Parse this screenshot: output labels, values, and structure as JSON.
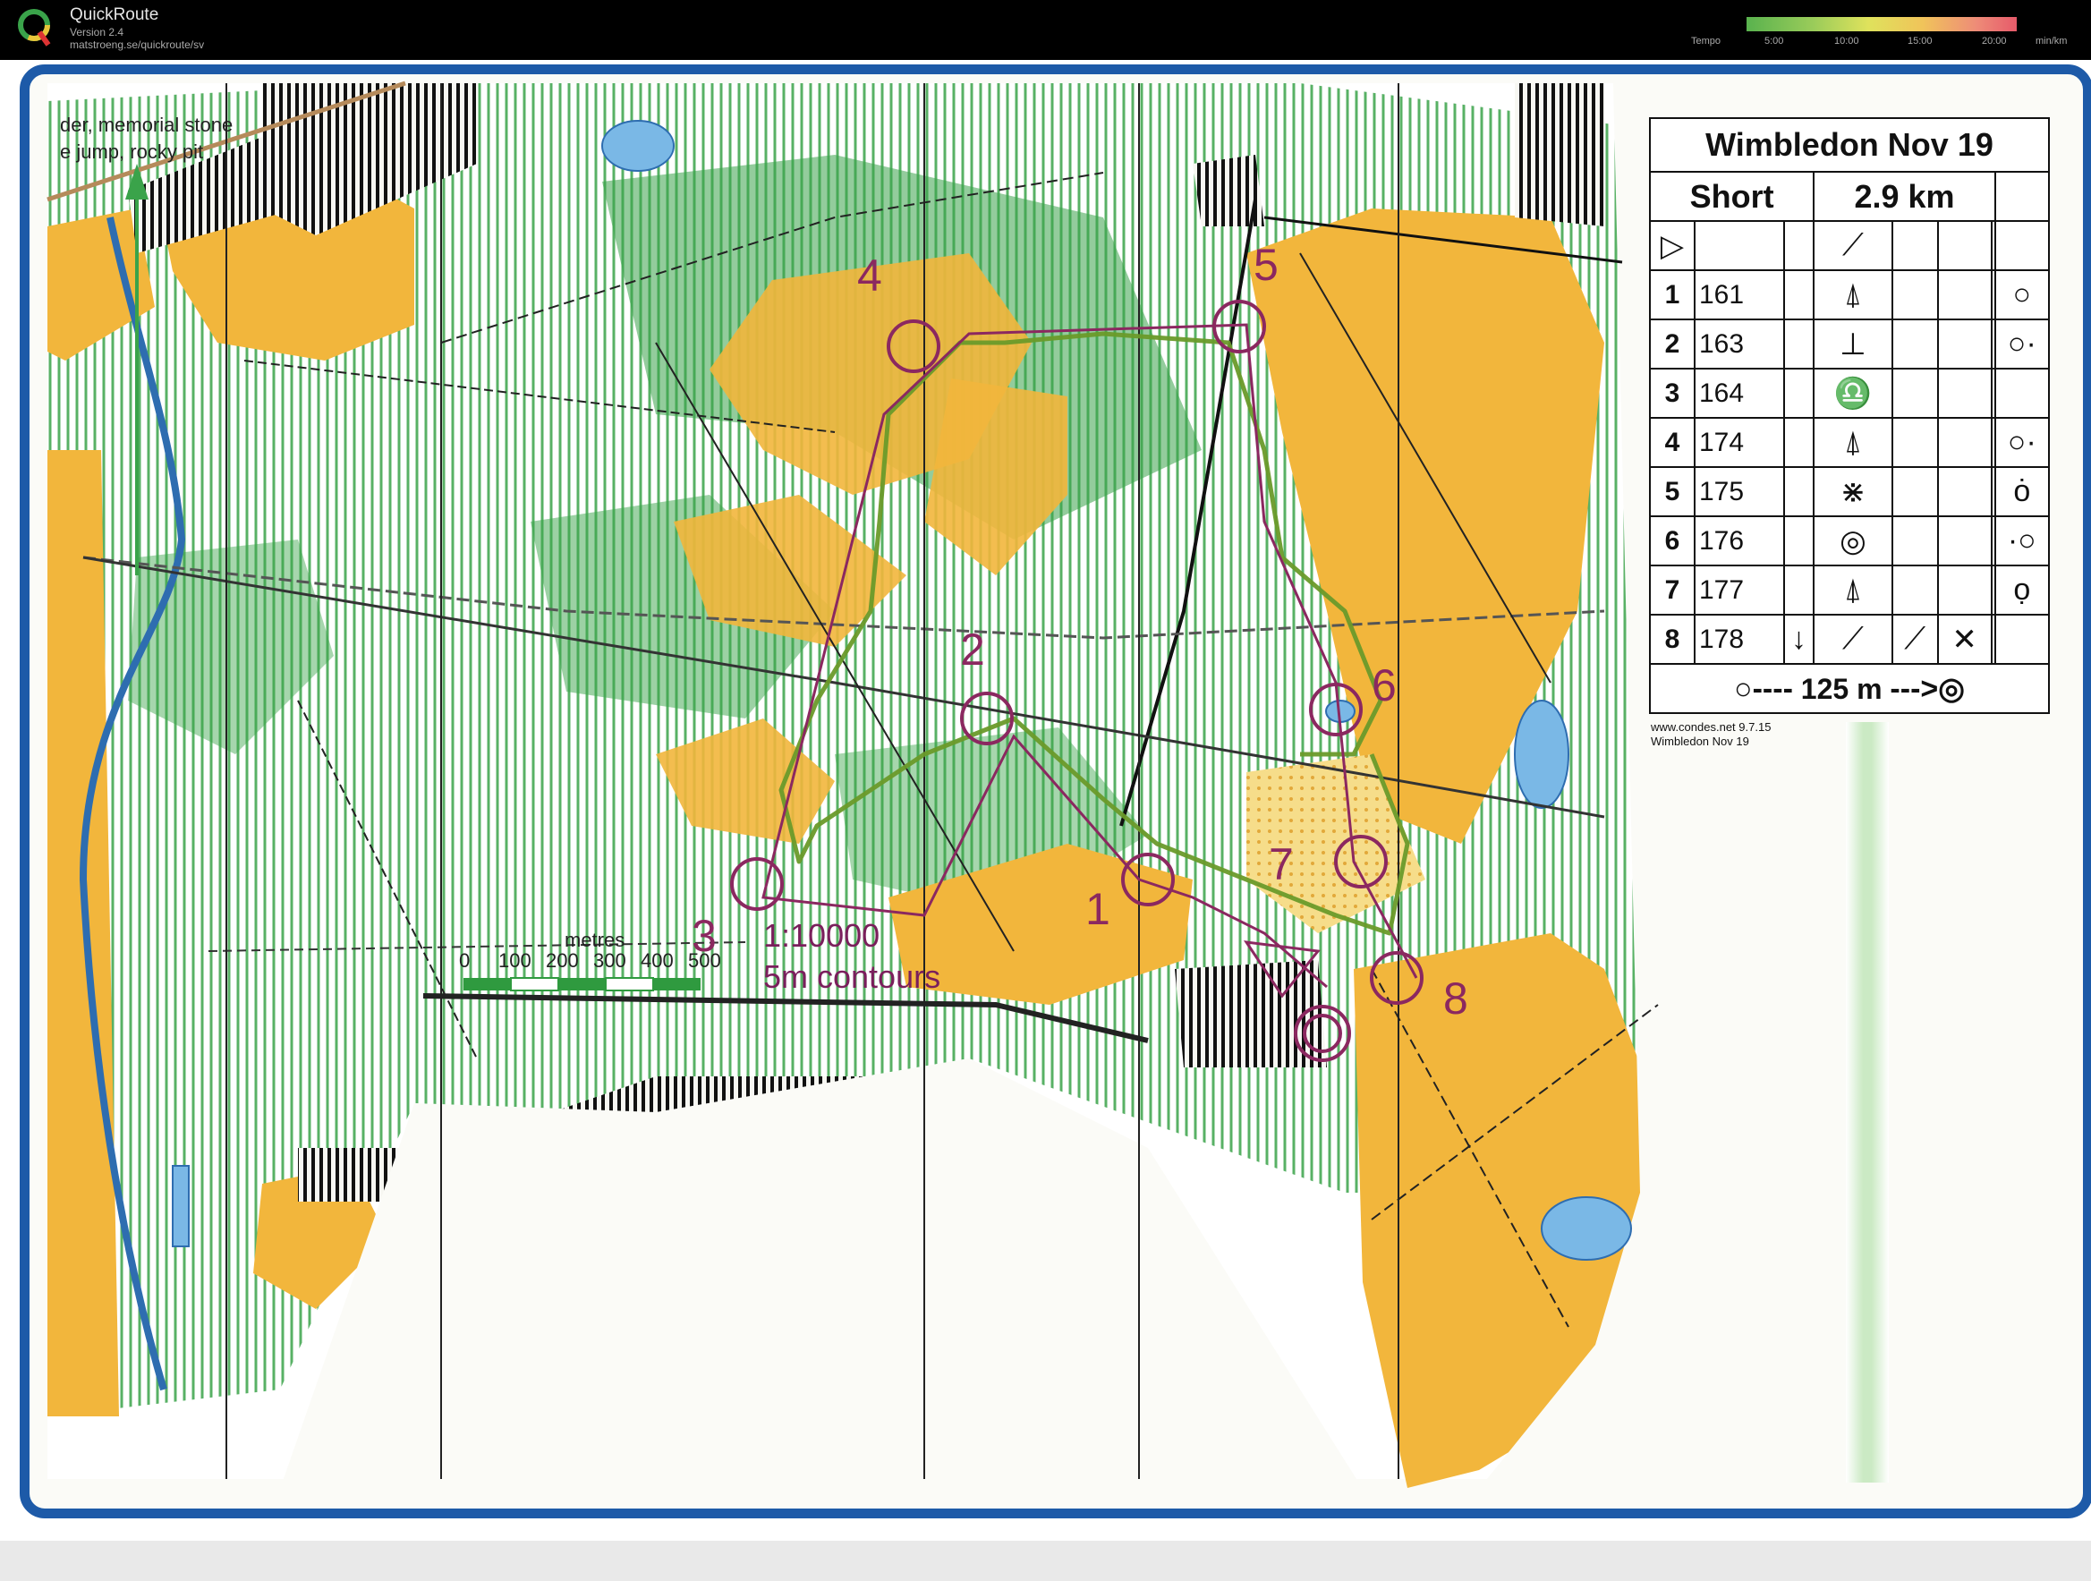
{
  "header": {
    "app_name": "QuickRoute",
    "version": "Version 2.4",
    "url": "matstroeng.se/quickroute/sv",
    "tempo_label": "Tempo",
    "tempo_ticks": [
      "5:00",
      "10:00",
      "15:00",
      "20:00"
    ],
    "tempo_unit": "min/km"
  },
  "map": {
    "legend_lines": "der, memorial stone\ne jump, rocky pit",
    "scale": {
      "title": "metres",
      "ticks": [
        "0",
        "100",
        "200",
        "300",
        "400",
        "500"
      ],
      "ratio": "1:10000",
      "contours": "5m contours"
    },
    "control_labels": [
      "1",
      "2",
      "3",
      "4",
      "5",
      "6",
      "7",
      "8"
    ],
    "colors": {
      "open_land": "#f2b63c",
      "forest": "#3aa34a",
      "water": "#7ab8e6",
      "course": "#8b2860",
      "route": "#6a9a2a",
      "frame": "#1d5aa8"
    }
  },
  "control_descriptions": {
    "title": "Wimbledon Nov 19",
    "course": "Short",
    "length": "2.9 km",
    "rows": [
      {
        "num": "1",
        "code": "161",
        "feature": "tree-icon",
        "detail": "circle-icon"
      },
      {
        "num": "2",
        "code": "163",
        "feature": "tower-icon",
        "detail": "circle-dot-icon"
      },
      {
        "num": "3",
        "code": "164",
        "feature": "stone-wall-icon",
        "detail": ""
      },
      {
        "num": "4",
        "code": "174",
        "feature": "tree-icon",
        "detail": "circle-dot-icon"
      },
      {
        "num": "5",
        "code": "175",
        "feature": "thicket-icon",
        "detail": "circle-top-icon"
      },
      {
        "num": "6",
        "code": "176",
        "feature": "depression-icon",
        "detail": "circle-dot-left-icon"
      },
      {
        "num": "7",
        "code": "177",
        "feature": "tree-icon",
        "detail": "circle-bottom-icon"
      },
      {
        "num": "8",
        "code": "178",
        "feature": "path-icon",
        "detail": "crossing-icon"
      }
    ],
    "footer": "125 m",
    "credit_line1": "www.condes.net 9.7.15",
    "credit_line2": "Wimbledon Nov 19"
  }
}
